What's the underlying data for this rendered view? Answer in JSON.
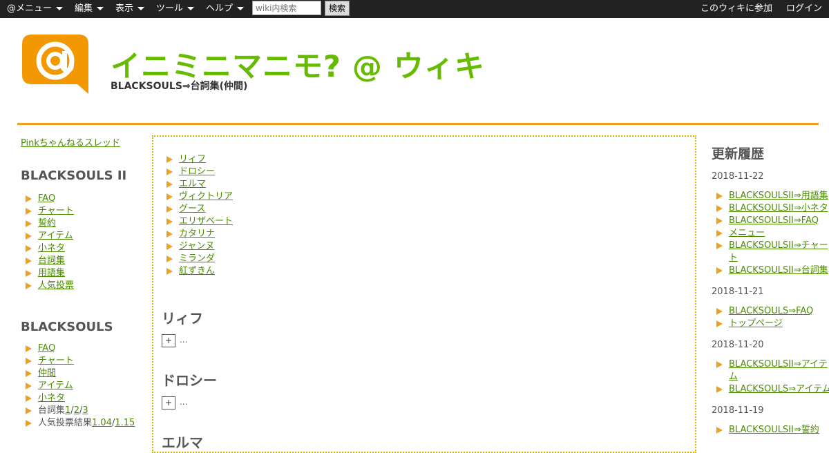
{
  "topbar": {
    "menus": [
      "@メニュー",
      "編集",
      "表示",
      "ツール",
      "ヘルプ"
    ],
    "search_placeholder": "wiki内検索",
    "search_button": "検索",
    "join_link": "このウィキに参加",
    "login_link": "ログイン"
  },
  "header": {
    "site_title": "イニミニマニモ? @ ウィキ",
    "page_title": "BLACKSOULS⇒台詞集(仲間)"
  },
  "colors": {
    "accent": "#66bb00",
    "logo": "#f39800",
    "rule": "#f0a020",
    "topbar": "#222222"
  },
  "left": {
    "pink_link": "Pinkちゃんねるスレッド",
    "section1": {
      "title": "BLACKSOULS II",
      "items": [
        "FAQ",
        "チャート",
        "誓約",
        "アイテム",
        "小ネタ",
        "台詞集",
        "用語集",
        "人気投票"
      ]
    },
    "section2": {
      "title": "BLACKSOULS",
      "items": [
        "FAQ",
        "チャート",
        "仲間",
        "アイテム",
        "小ネタ"
      ],
      "serifu_label": "台詞集",
      "serifu_links": [
        "1",
        "2",
        "3"
      ],
      "vote_label": "人気投票結果",
      "vote_links": [
        "1.04",
        "1.15"
      ]
    }
  },
  "main": {
    "toc": [
      "リィフ",
      "ドロシー",
      "エルマ",
      "ヴィクトリア",
      "グース",
      "エリザベート",
      "カタリナ",
      "ジャンヌ",
      "ミランダ",
      "紅ずきん"
    ],
    "sections": [
      {
        "heading": "リィフ",
        "toggle": "+",
        "ellipsis": "..."
      },
      {
        "heading": "ドロシー",
        "toggle": "+",
        "ellipsis": "..."
      },
      {
        "heading": "エルマ"
      }
    ]
  },
  "right": {
    "title": "更新履歴",
    "groups": [
      {
        "date": "2018-11-22",
        "items": [
          "BLACKSOULSII⇒用語集",
          "BLACKSOULSII⇒小ネタ",
          "BLACKSOULSII⇒FAQ",
          "メニュー",
          "BLACKSOULSII⇒チャート",
          "BLACKSOULSII⇒台詞集"
        ]
      },
      {
        "date": "2018-11-21",
        "items": [
          "BLACKSOULS⇒FAQ",
          "トップページ"
        ]
      },
      {
        "date": "2018-11-20",
        "items": [
          "BLACKSOULSII⇒アイテム",
          "BLACKSOULS⇒アイテム"
        ]
      },
      {
        "date": "2018-11-19",
        "items": [
          "BLACKSOULSII⇒誓約"
        ]
      }
    ]
  }
}
